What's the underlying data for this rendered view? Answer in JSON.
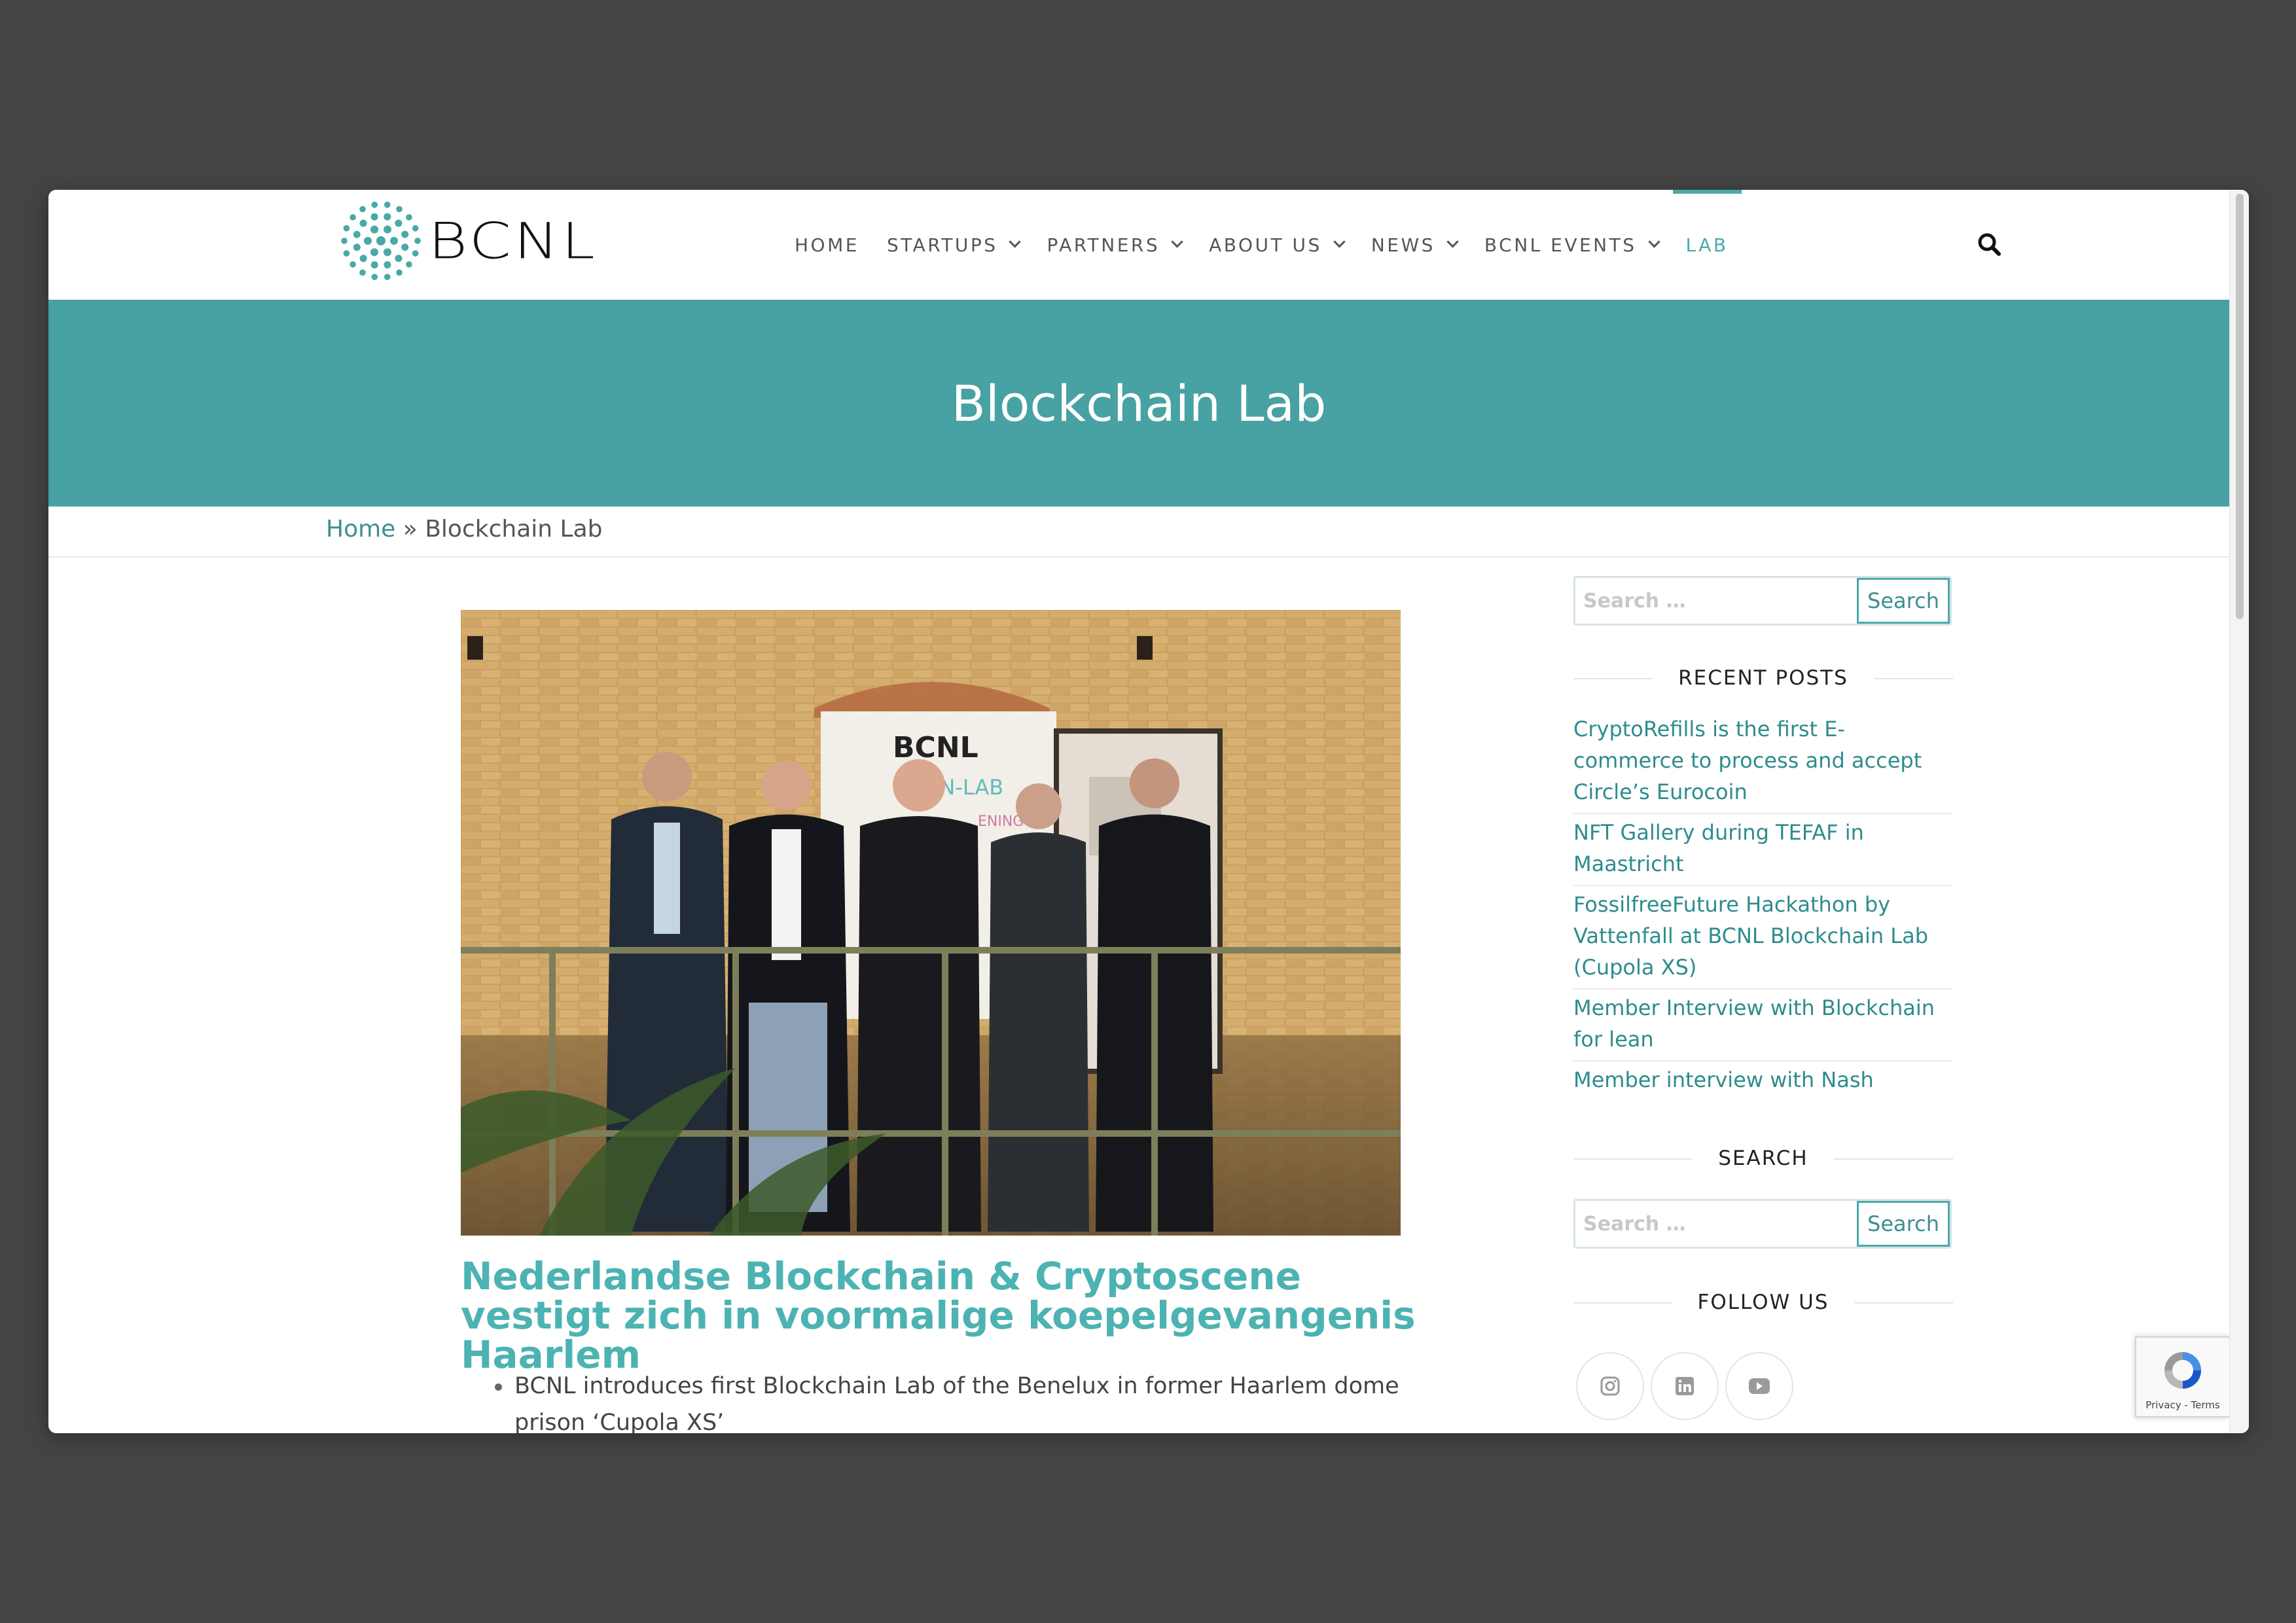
{
  "logo": {
    "text": "BCNL"
  },
  "nav": {
    "items": [
      {
        "label": "HOME",
        "dropdown": false,
        "active": false
      },
      {
        "label": "STARTUPS",
        "dropdown": true,
        "active": false
      },
      {
        "label": "PARTNERS",
        "dropdown": true,
        "active": false
      },
      {
        "label": "ABOUT US",
        "dropdown": true,
        "active": false
      },
      {
        "label": "NEWS",
        "dropdown": true,
        "active": false
      },
      {
        "label": "BCNL EVENTS",
        "dropdown": true,
        "active": false
      },
      {
        "label": "LAB",
        "dropdown": false,
        "active": true
      }
    ],
    "search_icon": "search-icon"
  },
  "hero": {
    "title": "Blockchain Lab"
  },
  "breadcrumb": {
    "home": "Home",
    "separator": " » ",
    "current": "Blockchain Lab"
  },
  "article": {
    "title": "Nederlandse Blockchain & Cryptoscene vestigt zich in voormalige koepelgevangenis Haarlem",
    "bullets": [
      "BCNL introduces first Blockchain Lab of the Benelux in former Haarlem dome prison ‘Cupola XS’"
    ],
    "image": {
      "poster_brand": "BCNL",
      "poster_line": "AIN-LAB",
      "poster_sub": "ENING"
    }
  },
  "sidebar": {
    "search1": {
      "placeholder": "Search …",
      "button": "Search"
    },
    "recent_posts": {
      "title": "RECENT POSTS",
      "items": [
        "CryptoRefills is the first E-commerce to process and accept Circle’s Eurocoin",
        "NFT Gallery during TEFAF in Maastricht",
        "FossilfreeFuture Hackathon by Vattenfall at BCNL Blockchain Lab (Cupola XS)",
        "Member Interview with Blockchain for lean",
        "Member interview with Nash"
      ]
    },
    "search_widget": {
      "title": "SEARCH",
      "placeholder": "Search …",
      "button": "Search"
    },
    "follow": {
      "title": "FOLLOW US",
      "icons": [
        "instagram-icon",
        "linkedin-icon",
        "youtube-icon"
      ]
    }
  },
  "recaptcha": {
    "links": "Privacy - Terms"
  },
  "colors": {
    "accent": "#48a1a2",
    "title": "#4cb3b2",
    "link": "#2e8c8d",
    "backdrop": "#444444"
  }
}
